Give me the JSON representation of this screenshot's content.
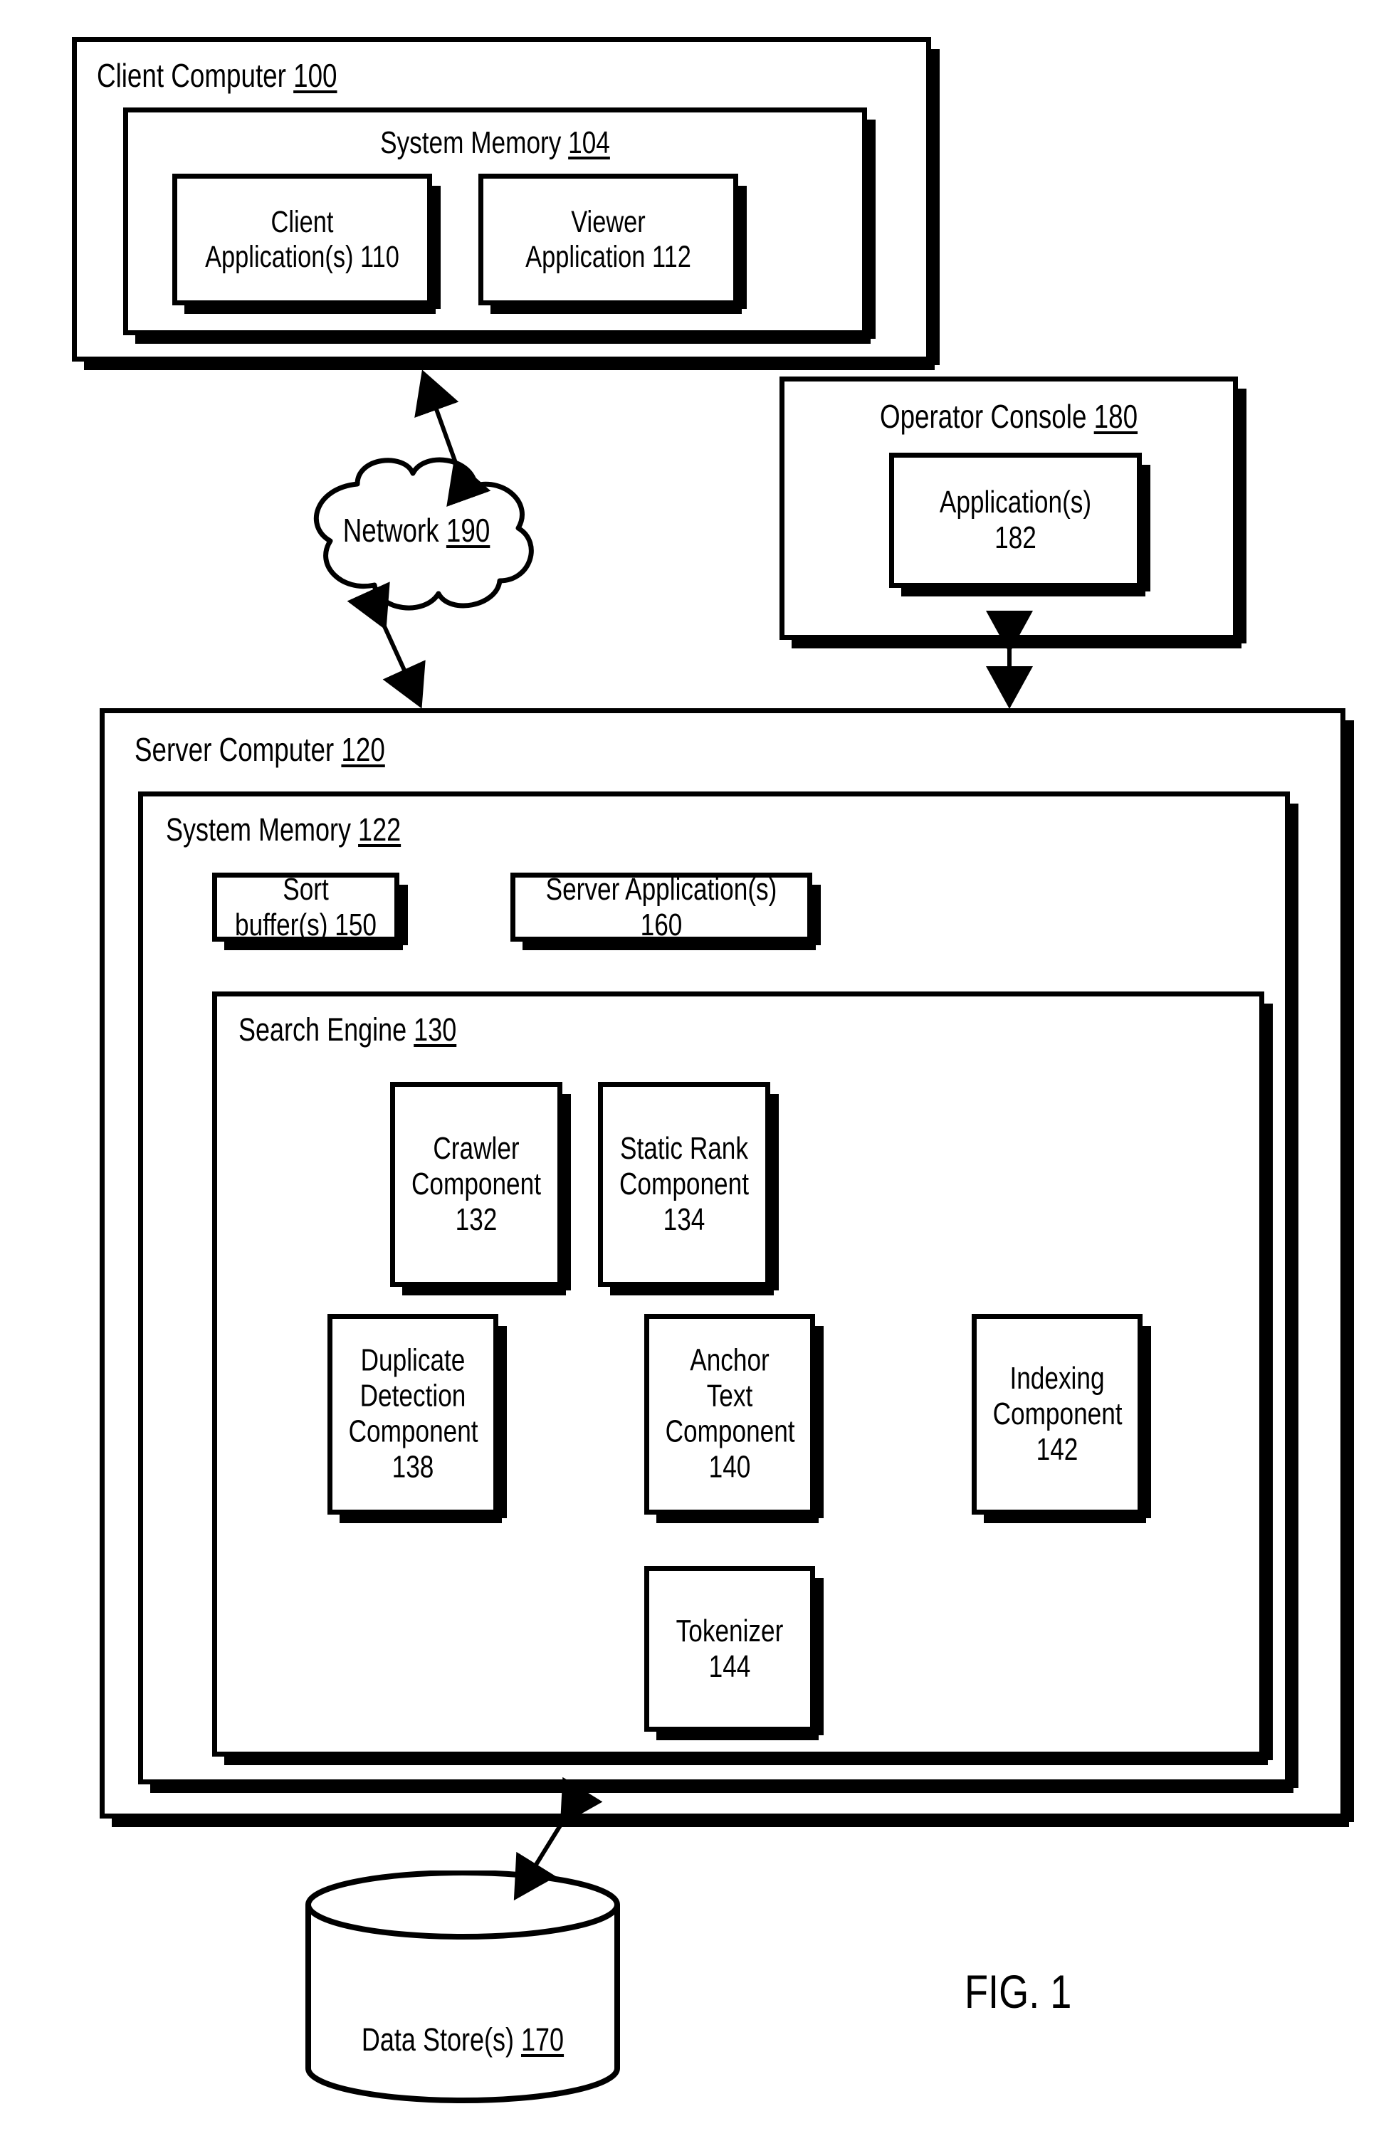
{
  "figure": {
    "caption": "FIG. 1"
  },
  "client_computer": {
    "title": "Client Computer",
    "ref": "100",
    "system_memory": {
      "title": "System Memory",
      "ref": "104",
      "boxes": [
        {
          "label": "Client\nApplication(s)",
          "ref": "110"
        },
        {
          "label": "Viewer\nApplication",
          "ref": "112"
        }
      ]
    }
  },
  "network": {
    "label": "Network",
    "ref": "190"
  },
  "operator_console": {
    "title": "Operator Console",
    "ref": "180",
    "application": {
      "label": "Application(s)",
      "ref": "182"
    }
  },
  "server_computer": {
    "title": "Server Computer",
    "ref": "120",
    "system_memory": {
      "title": "System Memory",
      "ref": "122",
      "sort_buffer": {
        "label": "Sort buffer(s)",
        "ref": "150"
      },
      "server_application": {
        "label": "Server Application(s)",
        "ref": "160"
      },
      "search_engine": {
        "title": "Search Engine",
        "ref": "130",
        "components": [
          {
            "label": "Crawler\nComponent",
            "ref": "132"
          },
          {
            "label": "Static Rank\nComponent",
            "ref": "134"
          },
          {
            "label": "Duplicate\nDetection\nComponent",
            "ref": "138"
          },
          {
            "label": "Anchor Text\nComponent",
            "ref": "140"
          },
          {
            "label": "Indexing\nComponent",
            "ref": "142"
          },
          {
            "label": "Tokenizer",
            "ref": "144"
          }
        ]
      }
    }
  },
  "data_store": {
    "label": "Data Store(s)",
    "ref": "170"
  },
  "colors": {
    "line": "#000000",
    "background": "#ffffff"
  }
}
